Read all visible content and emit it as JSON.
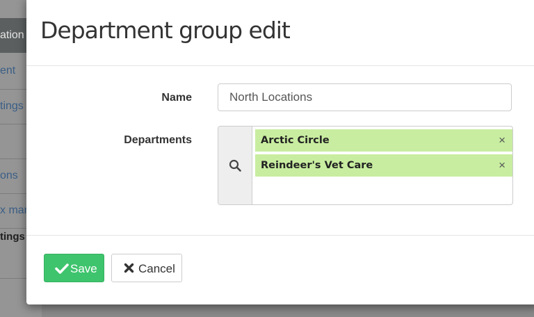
{
  "background": {
    "header_fragment": "ation",
    "items": [
      {
        "text": "ent"
      },
      {
        "text": "tings"
      },
      {
        "text": "ons"
      },
      {
        "text": "x mar"
      },
      {
        "text": "tings"
      }
    ]
  },
  "modal": {
    "title": "Department group edit",
    "name_label": "Name",
    "name_value": "North Locations",
    "departments_label": "Departments",
    "departments": [
      {
        "label": "Arctic Circle",
        "remove": "×"
      },
      {
        "label": "Reindeer's Vet Care",
        "remove": "×"
      }
    ],
    "save_label": "Save",
    "cancel_label": "Cancel"
  },
  "colors": {
    "chip_bg": "#c8eda0",
    "save_bg": "#3ec46d",
    "overlay": "#8a8a8a"
  },
  "icons": [
    "search-icon",
    "check-icon",
    "x-icon",
    "remove-icon"
  ]
}
